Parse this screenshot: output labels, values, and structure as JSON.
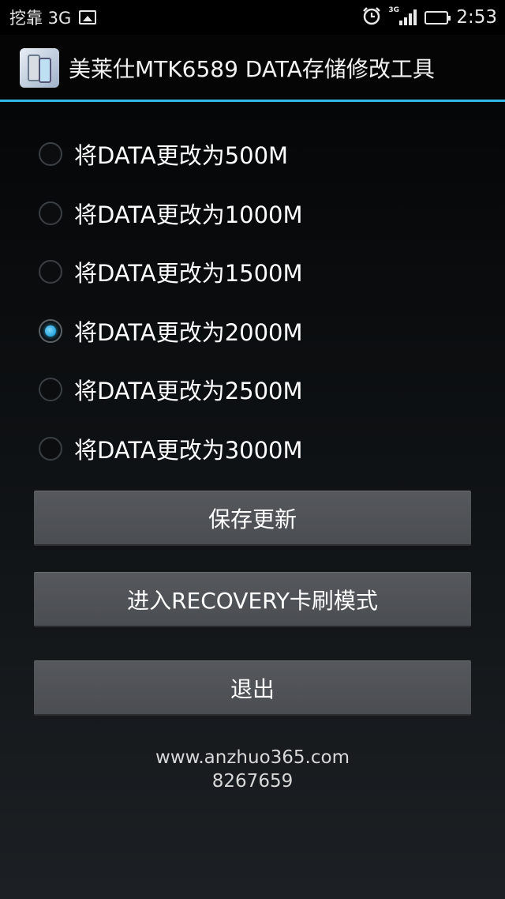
{
  "status_bar": {
    "carrier": "挖靠 3G",
    "network_tag": "3G",
    "time": "2:53",
    "icons": [
      "image-icon",
      "alarm-icon",
      "signal-icon",
      "battery-icon"
    ],
    "battery_color": "#6cd14a"
  },
  "action_bar": {
    "title": "美莱仕MTK6589 DATA存储修改工具",
    "divider_color": "#33b5e5"
  },
  "options": [
    {
      "label": "将DATA更改为500M",
      "checked": false
    },
    {
      "label": "将DATA更改为1000M",
      "checked": false
    },
    {
      "label": "将DATA更改为1500M",
      "checked": false
    },
    {
      "label": "将DATA更改为2000M",
      "checked": true
    },
    {
      "label": "将DATA更改为2500M",
      "checked": false
    },
    {
      "label": "将DATA更改为3000M",
      "checked": false
    }
  ],
  "buttons": {
    "save": "保存更新",
    "recovery": "进入RECOVERY卡刷模式",
    "exit": "退出"
  },
  "footer": {
    "website": "www.anzhuo365.com",
    "code": "8267659"
  }
}
